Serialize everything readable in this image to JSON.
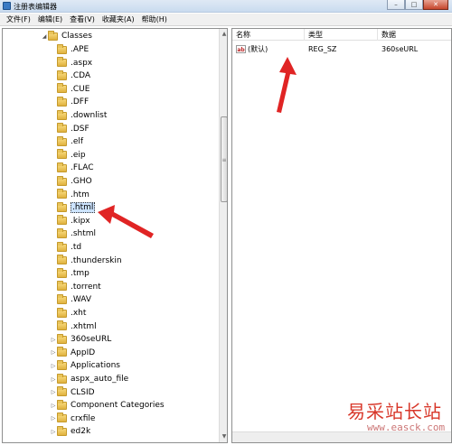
{
  "window": {
    "title": "注册表编辑器"
  },
  "menu": [
    "文件(F)",
    "编辑(E)",
    "查看(V)",
    "收藏夹(A)",
    "帮助(H)"
  ],
  "tree": {
    "root": "Classes",
    "items": [
      ".APE",
      ".aspx",
      ".CDA",
      ".CUE",
      ".DFF",
      ".downlist",
      ".DSF",
      ".elf",
      ".eip",
      ".FLAC",
      ".GHO",
      ".htm",
      ".html",
      ".kipx",
      ".shtml",
      ".td",
      ".thunderskin",
      ".tmp",
      ".torrent",
      ".WAV",
      ".xht",
      ".xhtml",
      "360seURL",
      "AppID",
      "Applications",
      "aspx_auto_file",
      "CLSID",
      "Component Categories",
      "crxfile",
      "ed2k"
    ],
    "selected": ".html"
  },
  "list": {
    "headers": {
      "name": "名称",
      "type": "类型",
      "data": "数据"
    },
    "rows": [
      {
        "name": "(默认)",
        "type": "REG_SZ",
        "data": "360seURL",
        "icon": "ab"
      }
    ]
  },
  "watermark": {
    "main": "易采站长站",
    "sub": "www.easck.com"
  },
  "colors": {
    "arrow": "#e02424",
    "watermark": "#d8382b"
  }
}
